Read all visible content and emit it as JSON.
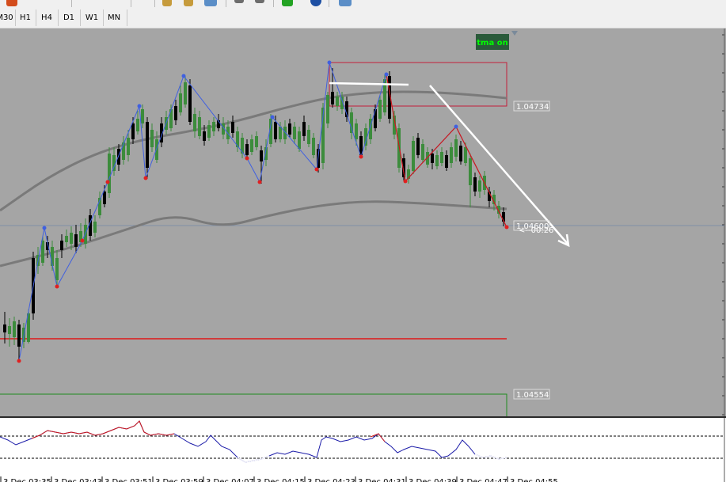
{
  "toolbar": {
    "timeframes": [
      {
        "label": "M30",
        "active": false
      },
      {
        "label": "H1",
        "active": false
      },
      {
        "label": "H4",
        "active": false
      },
      {
        "label": "D1",
        "active": false
      },
      {
        "label": "W1",
        "active": false
      },
      {
        "label": "MN",
        "active": false
      }
    ],
    "icons": [
      "zoom-in-icon",
      "zoom-out-icon",
      "tile-windows-icon",
      "navigator-icon",
      "new-order-icon",
      "autotrading-icon",
      "strategy-tester-icon"
    ]
  },
  "chart": {
    "background": "#a5a5a5",
    "bull_color": "#3c8c3c",
    "bear_color": "#000000",
    "ma_color": "#7a7a7a",
    "zigzag_up_color": "#4060e0",
    "zigzag_down_color": "#e02020",
    "badge_text": "tma on",
    "badge_color": "#00ff00",
    "price_labels": [
      "1.04734",
      "1.04600",
      "1.04554"
    ],
    "overlap_label": "<--00:26"
  },
  "chart_data": {
    "type": "candlestick",
    "x_tick_labels": [
      "3 Dec 03:35",
      "3 Dec 03:43",
      "3 Dec 03:51",
      "3 Dec 03:59",
      "3 Dec 04:07",
      "3 Dec 04:15",
      "3 Dec 04:23",
      "3 Dec 04:31",
      "3 Dec 04:39",
      "3 Dec 04:47",
      "3 Dec 04:55"
    ],
    "y_labels_shown": [
      1.04734,
      1.046,
      1.04554
    ],
    "horizontal_lines": [
      {
        "price": 1.046,
        "style": "thin"
      },
      {
        "price": 1.04554,
        "style": "box-bottom"
      }
    ]
  }
}
